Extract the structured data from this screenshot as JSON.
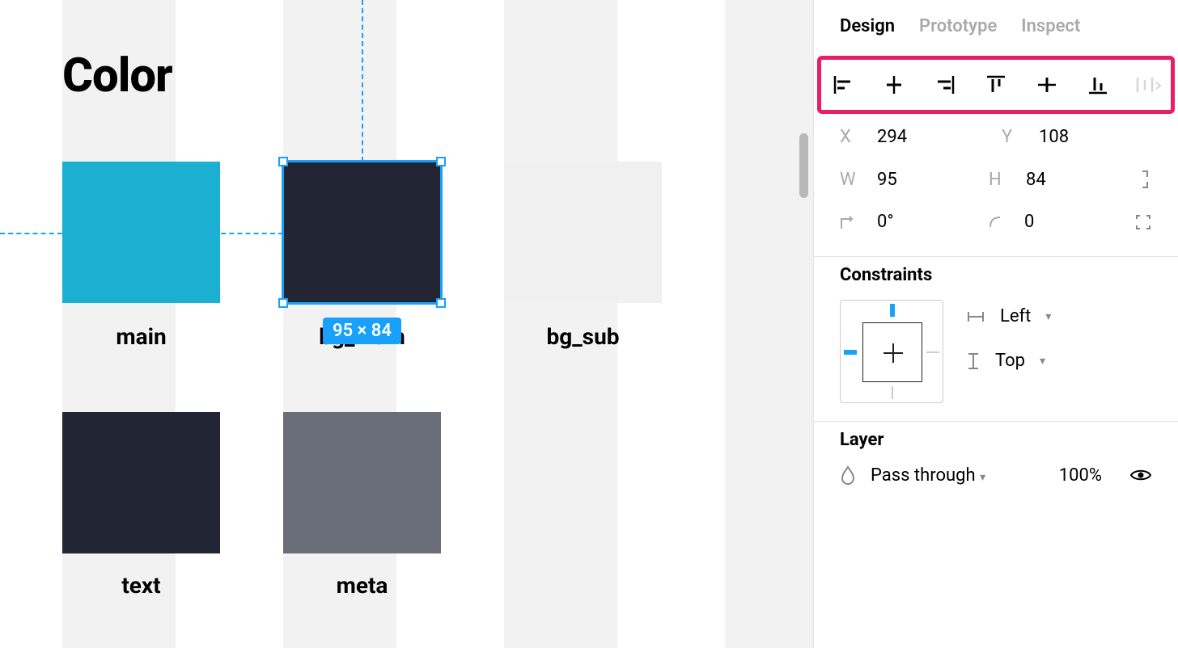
{
  "canvas": {
    "title": "Color",
    "selection_badge": "95 × 84",
    "swatches": [
      {
        "id": "main",
        "label": "main",
        "color": "#1bb0d1"
      },
      {
        "id": "bg_main",
        "label": "bg_main",
        "color": "#222634",
        "selected": true
      },
      {
        "id": "bg_sub",
        "label": "bg_sub",
        "color": "#f0f0f1"
      },
      {
        "id": "text",
        "label": "text",
        "color": "#222634"
      },
      {
        "id": "meta",
        "label": "meta",
        "color": "#6a6e78"
      }
    ]
  },
  "panel": {
    "tabs": {
      "design": "Design",
      "prototype": "Prototype",
      "inspect": "Inspect",
      "active": "design"
    },
    "position": {
      "x_label": "X",
      "x_value": "294",
      "y_label": "Y",
      "y_value": "108",
      "w_label": "W",
      "w_value": "95",
      "h_label": "H",
      "h_value": "84",
      "rotation_value": "0°",
      "radius_value": "0"
    },
    "constraints": {
      "title": "Constraints",
      "horizontal": "Left",
      "vertical": "Top"
    },
    "layer": {
      "title": "Layer",
      "blend_mode": "Pass through",
      "opacity": "100%"
    }
  }
}
